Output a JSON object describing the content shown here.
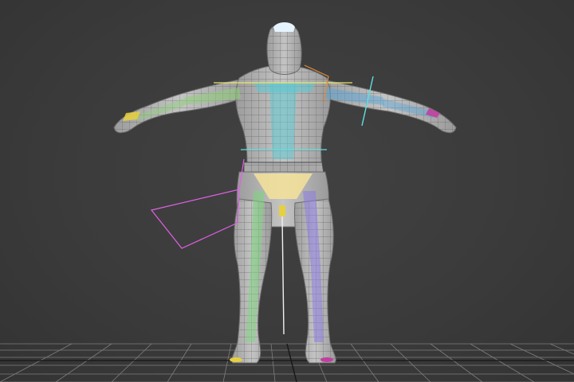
{
  "viewport": {
    "background_color": "#3a3a3a",
    "grid_color": "#8a8a8a",
    "grid_highlight_color": "#111111"
  },
  "model": {
    "mesh_color": "#b9b9b9",
    "wire_color": "#5c5c5c",
    "head_highlight_color": "#e6f4ff"
  },
  "rig": {
    "spine_color": "#5fc6cf",
    "left_arm_color": "#8fd07a",
    "right_arm_color": "#5aa6d8",
    "left_leg_color": "#7cd67c",
    "right_leg_color": "#8a7ce0",
    "pelvis_color": "#f4e39a",
    "left_hand_color": "#e6d040",
    "right_hand_color": "#c040a0",
    "helper_color": "#e060e6",
    "shoulder_line_color": "#e8e86a",
    "upperarm_line_color": "#5fe0e0",
    "clavicle_line_color": "#e08a3a"
  }
}
